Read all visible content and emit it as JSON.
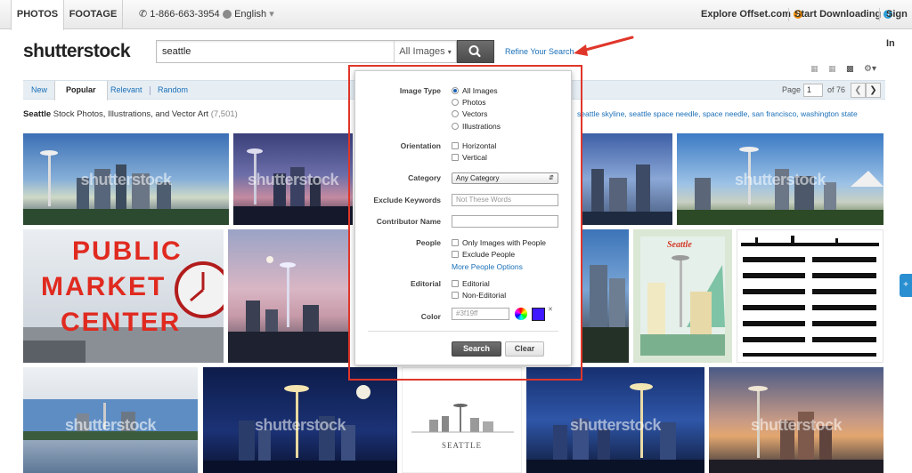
{
  "topbar": {
    "tabs": [
      {
        "label": "PHOTOS"
      },
      {
        "label": "FOOTAGE"
      }
    ],
    "phone": "1-866-663-3954",
    "language": "English",
    "explore": "Explore Offset.com",
    "start": "Start Downloading",
    "signin": "Sign In"
  },
  "logo": "shutterstock",
  "search": {
    "query": "seattle",
    "type_label": "All Images",
    "refine_link": "Refine Your Search"
  },
  "subnav": {
    "tabs": [
      "New",
      "Popular",
      "Relevant",
      "Random"
    ],
    "active_tab": "Popular",
    "page_label": "Page",
    "page_value": "1",
    "page_total": "of 76"
  },
  "results": {
    "keyword": "Seattle",
    "title_rest": "Stock Photos, Illustrations, and Vector Art",
    "count": "(7,501)",
    "related": [
      "seattle skyline,",
      "seattle space needle,",
      "space needle,",
      "san francisco,",
      "washington state"
    ]
  },
  "watermark": "shutterstock",
  "refine": {
    "image_type_label": "Image Type",
    "image_types": [
      "All Images",
      "Photos",
      "Vectors",
      "Illustrations"
    ],
    "orientation_label": "Orientation",
    "orientations": [
      "Horizontal",
      "Vertical"
    ],
    "category_label": "Category",
    "category_value": "Any Category",
    "exclude_label": "Exclude Keywords",
    "exclude_placeholder": "Not These Words",
    "contributor_label": "Contributor Name",
    "people_label": "People",
    "people_opts": [
      "Only Images with People",
      "Exclude People"
    ],
    "more_people": "More People Options",
    "editorial_label": "Editorial",
    "editorial_opts": [
      "Editorial",
      "Non-Editorial"
    ],
    "color_label": "Color",
    "color_value": "#3f19ff",
    "swatch": "#3f19ff",
    "search_btn": "Search",
    "clear_btn": "Clear"
  },
  "tiles": {
    "market_lines": [
      "PUBLIC",
      "MARKET",
      "CENTER"
    ],
    "poster_title": "Seattle",
    "vector_title": "SEATTLE"
  },
  "colors": {
    "accent": "#1a6fb7",
    "highlight": "#e0362a"
  }
}
